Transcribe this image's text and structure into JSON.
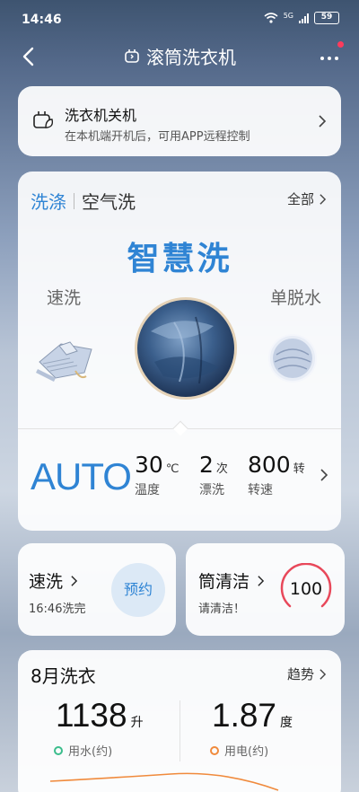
{
  "status_bar": {
    "time": "14:46",
    "network": "5G",
    "battery": "59"
  },
  "nav": {
    "title": "滚筒洗衣机"
  },
  "power_card": {
    "title": "洗衣机关机",
    "subtitle": "在本机端开机后，可用APP远程控制"
  },
  "mode_card": {
    "tab_active": "洗涤",
    "tab_inactive": "空气洗",
    "all_label": "全部",
    "selected_mode": "智慧洗",
    "prev_mode": "速洗",
    "next_mode": "单脱水",
    "auto_label": "AUTO",
    "settings": [
      {
        "value": "30",
        "unit": "℃",
        "label": "温度"
      },
      {
        "value": "2",
        "unit": "次",
        "label": "漂洗"
      },
      {
        "value": "800",
        "unit": "转",
        "label": "转速"
      }
    ]
  },
  "quick_card": {
    "title": "速洗",
    "subtitle": "16:46洗完",
    "button": "预约"
  },
  "drum_card": {
    "title": "筒清洁",
    "subtitle": "请清洁！",
    "value": "100"
  },
  "monthly_card": {
    "title": "8月洗衣",
    "trend_label": "趋势",
    "water": {
      "value": "1138",
      "unit": "升",
      "label": "用水(约)",
      "color": "#3bbd8c"
    },
    "power": {
      "value": "1.87",
      "unit": "度",
      "label": "用电(约)",
      "color": "#f08a3c"
    }
  },
  "colors": {
    "accent": "#2f84d4",
    "warning_ring": "#e8485a"
  }
}
